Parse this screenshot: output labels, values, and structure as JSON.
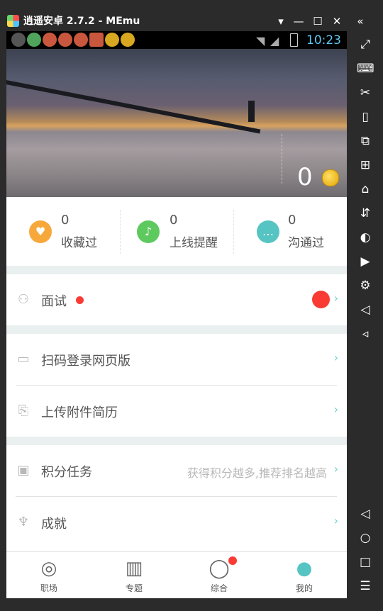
{
  "window": {
    "title": "逍遥安卓 2.7.2 - MEmu"
  },
  "status_bar": {
    "time": "10:23"
  },
  "hero": {
    "points": "0"
  },
  "stats": [
    {
      "count": "0",
      "label": "收藏过",
      "color": "#f7a83b"
    },
    {
      "count": "0",
      "label": "上线提醒",
      "color": "#5dc95e"
    },
    {
      "count": "0",
      "label": "沟通过",
      "color": "#56c4c3"
    }
  ],
  "menu": {
    "interview": {
      "label": "面试"
    },
    "scan_login": {
      "label": "扫码登录网页版"
    },
    "upload_resume": {
      "label": "上传附件简历"
    },
    "points_task": {
      "label": "积分任务",
      "hint": "获得积分越多,推荐排名越高"
    },
    "achievement": {
      "label": "成就"
    }
  },
  "tabs": [
    {
      "label": "职场",
      "icon": "planet-icon"
    },
    {
      "label": "专题",
      "icon": "building-icon"
    },
    {
      "label": "综合",
      "icon": "chat-bubble-icon"
    },
    {
      "label": "我的",
      "icon": "person-icon",
      "active": true
    }
  ],
  "colors": {
    "accent": "#56c4c3",
    "badge": "#f93b33",
    "chevron": "#6ed0cf"
  }
}
